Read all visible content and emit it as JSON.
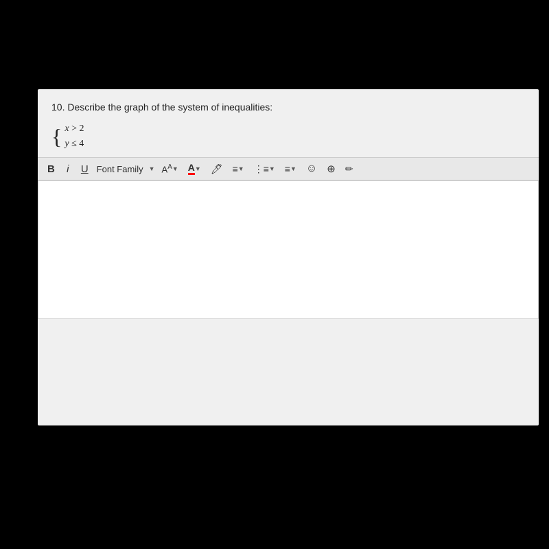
{
  "question": {
    "number": "10.",
    "text": "Describe the graph of the system of inequalities:",
    "equations": [
      "x > 2",
      "y ≤ 4"
    ]
  },
  "toolbar": {
    "bold_label": "B",
    "italic_label": "i",
    "underline_label": "U",
    "font_family_label": "Font Family",
    "dropdown_arrow": "▼",
    "aa_label": "AA",
    "color_icon": "A",
    "paint_icon": "🎨",
    "align_icon": "≡",
    "list_icon": "≡",
    "emoji_icon": "☺",
    "link_icon": "⊕",
    "edit_icon": "✏"
  },
  "editor": {
    "placeholder": ""
  }
}
